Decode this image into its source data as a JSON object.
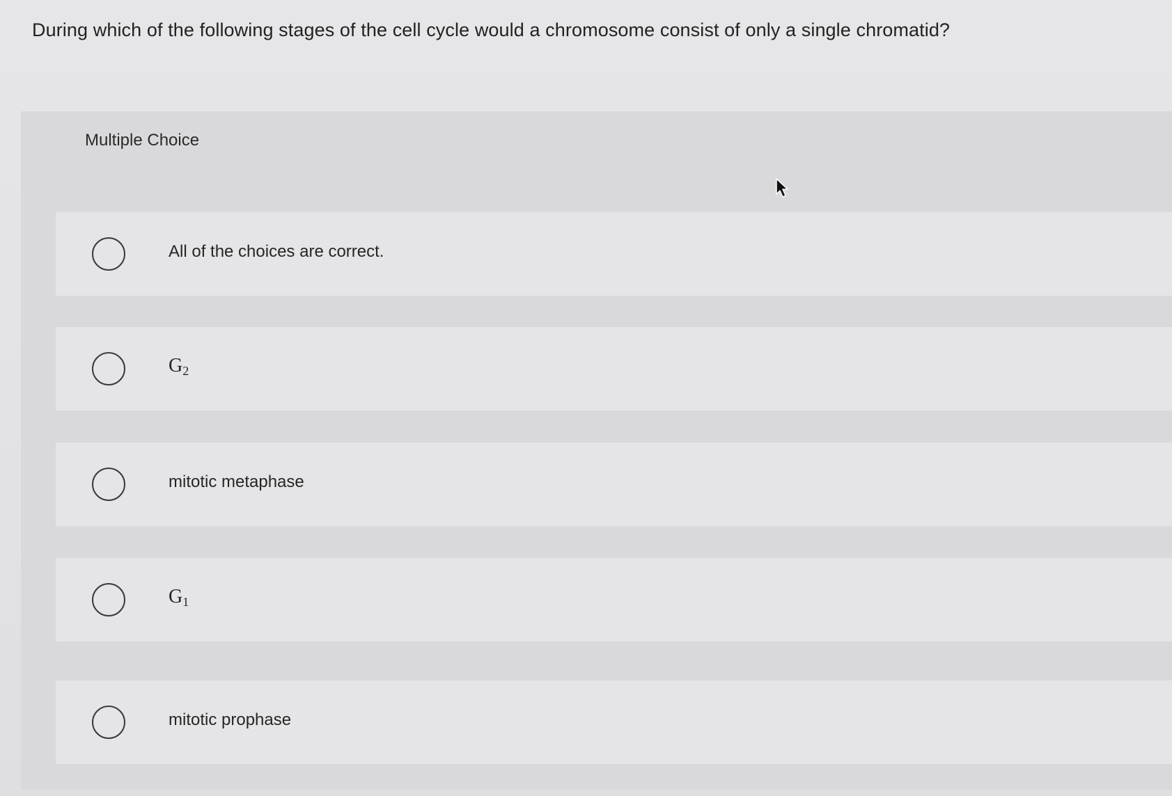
{
  "question": {
    "text": "During which of the following stages of the cell cycle would a chromosome consist of only a single chromatid?"
  },
  "multiple_choice": {
    "label": "Multiple Choice",
    "options": [
      {
        "label": "All of the choices are correct.",
        "selected": false
      },
      {
        "label_base": "G",
        "label_sub": "2",
        "selected": false
      },
      {
        "label": "mitotic metaphase",
        "selected": false
      },
      {
        "label_base": "G",
        "label_sub": "1",
        "selected": false
      },
      {
        "label": "mitotic prophase",
        "selected": false
      }
    ]
  },
  "icons": {
    "radio": "radio-unchecked-icon",
    "cursor": "mouse-pointer-icon"
  },
  "colors": {
    "background": "#e4e4e6",
    "panel": "#d9d9db",
    "option": "#e5e5e7",
    "text": "#222222"
  }
}
